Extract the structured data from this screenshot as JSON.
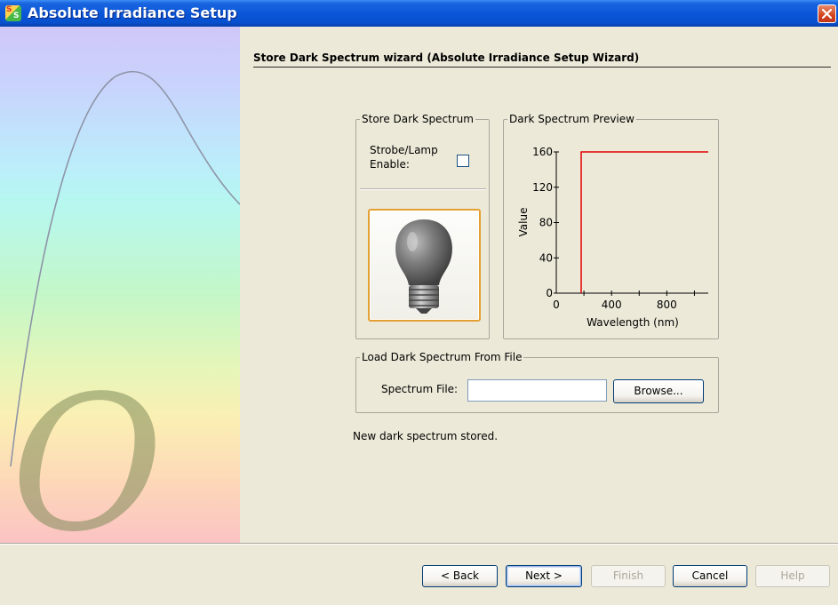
{
  "window": {
    "title": "Absolute Irradiance Setup",
    "close_icon": "close-icon",
    "app_icon": "spectrasuite-icon"
  },
  "wizard": {
    "title": "Store Dark Spectrum wizard (Absolute Irradiance Setup Wizard)"
  },
  "store_dark": {
    "legend": "Store Dark Spectrum",
    "strobe_label_line1": "Strobe/Lamp",
    "strobe_label_line2": "Enable:",
    "strobe_checked": false,
    "lamp_icon": "light-bulb-icon"
  },
  "preview": {
    "legend": "Dark Spectrum Preview"
  },
  "chart_data": {
    "type": "line",
    "xlabel": "Wavelength (nm)",
    "ylabel": "Value",
    "xlim": [
      0,
      1100
    ],
    "ylim": [
      0,
      160
    ],
    "xticks": [
      0,
      400,
      800
    ],
    "yticks": [
      0,
      40,
      80,
      120,
      160
    ],
    "series": [
      {
        "color": "#e00000",
        "x": [
          180,
          180,
          1100
        ],
        "y": [
          0,
          160,
          160
        ]
      }
    ]
  },
  "load_file": {
    "legend": "Load Dark Spectrum From File",
    "file_label": "Spectrum File:",
    "file_value": "",
    "browse_label": "Browse..."
  },
  "status": "New dark spectrum stored.",
  "buttons": {
    "back": "< Back",
    "next": "Next >",
    "finish": "Finish",
    "cancel": "Cancel",
    "help": "Help"
  }
}
